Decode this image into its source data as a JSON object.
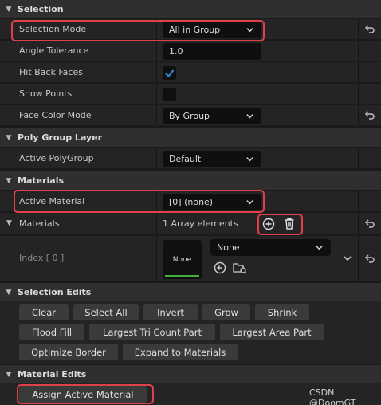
{
  "selection": {
    "header": "Selection",
    "mode_label": "Selection Mode",
    "mode_value": "All in Group",
    "angle_label": "Angle Tolerance",
    "angle_value": "1.0",
    "hit_back_label": "Hit Back Faces",
    "hit_back_checked": true,
    "show_points_label": "Show Points",
    "show_points_checked": false,
    "face_color_label": "Face Color Mode",
    "face_color_value": "By Group"
  },
  "poly_group": {
    "header": "Poly Group Layer",
    "active_label": "Active PolyGroup",
    "active_value": "Default"
  },
  "materials": {
    "header": "Materials",
    "active_label": "Active Material",
    "active_value": "[0] (none)",
    "array_label": "Materials",
    "array_count": "1 Array elements",
    "index_label": "Index [ 0 ]",
    "thumb_text": "None",
    "asset_value": "None"
  },
  "selection_edits": {
    "header": "Selection Edits",
    "buttons_row1": [
      "Clear",
      "Select All",
      "Invert",
      "Grow",
      "Shrink"
    ],
    "buttons_row2": [
      "Flood Fill",
      "Largest Tri Count Part",
      "Largest Area Part"
    ],
    "buttons_row3": [
      "Optimize Border",
      "Expand to Materials"
    ]
  },
  "material_edits": {
    "header": "Material Edits",
    "assign_label": "Assign Active Material"
  },
  "watermark": "CSDN @DoomGT",
  "colors": {
    "highlight": "#e0404a",
    "checkbox_check": "#3d8bd6",
    "thumb_underline": "#3fae3f"
  }
}
